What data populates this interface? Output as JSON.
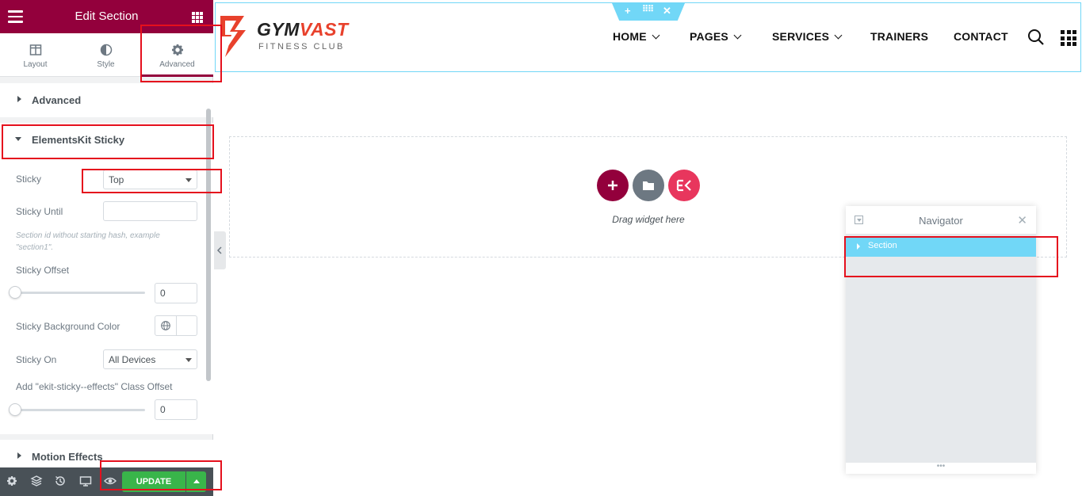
{
  "panel": {
    "title": "Edit Section",
    "tabs": [
      {
        "label": "Layout",
        "icon": "columns-icon"
      },
      {
        "label": "Style",
        "icon": "half-circle-icon"
      },
      {
        "label": "Advanced",
        "icon": "gear-icon",
        "active": true
      }
    ],
    "sections": {
      "advanced": "Advanced",
      "sticky": "ElementsKit Sticky",
      "motion": "Motion Effects"
    },
    "controls": {
      "sticky_label": "Sticky",
      "sticky_value": "Top",
      "sticky_until_label": "Sticky Until",
      "sticky_until_value": "",
      "sticky_until_desc": "Section id without starting hash, example \"section1\".",
      "sticky_offset_label": "Sticky Offset",
      "sticky_offset_value": "0",
      "bg_color_label": "Sticky Background Color",
      "sticky_on_label": "Sticky On",
      "sticky_on_value": "All Devices",
      "class_offset_label": "Add \"ekit-sticky--effects\" Class Offset",
      "class_offset_value": "0"
    },
    "footer": {
      "icons": [
        "gear-icon",
        "layers-icon",
        "history-icon",
        "desktop-icon",
        "eye-icon"
      ],
      "update_label": "UPDATE"
    }
  },
  "site": {
    "logo": {
      "brand_dark": "GYM",
      "brand_accent": "VAST",
      "tagline": "FITNESS CLUB"
    },
    "nav": [
      "HOME",
      "PAGES",
      "SERVICES",
      "TRAINERS",
      "CONTACT"
    ]
  },
  "canvas": {
    "drag_text": "Drag widget here",
    "colors": {
      "add": "#93003c",
      "template": "#6d7882",
      "ekit": "#e8365d",
      "accent": "#71d7f7",
      "brand": "#93003c",
      "update": "#39b54a"
    }
  },
  "navigator": {
    "title": "Navigator",
    "row_label": "Section"
  }
}
